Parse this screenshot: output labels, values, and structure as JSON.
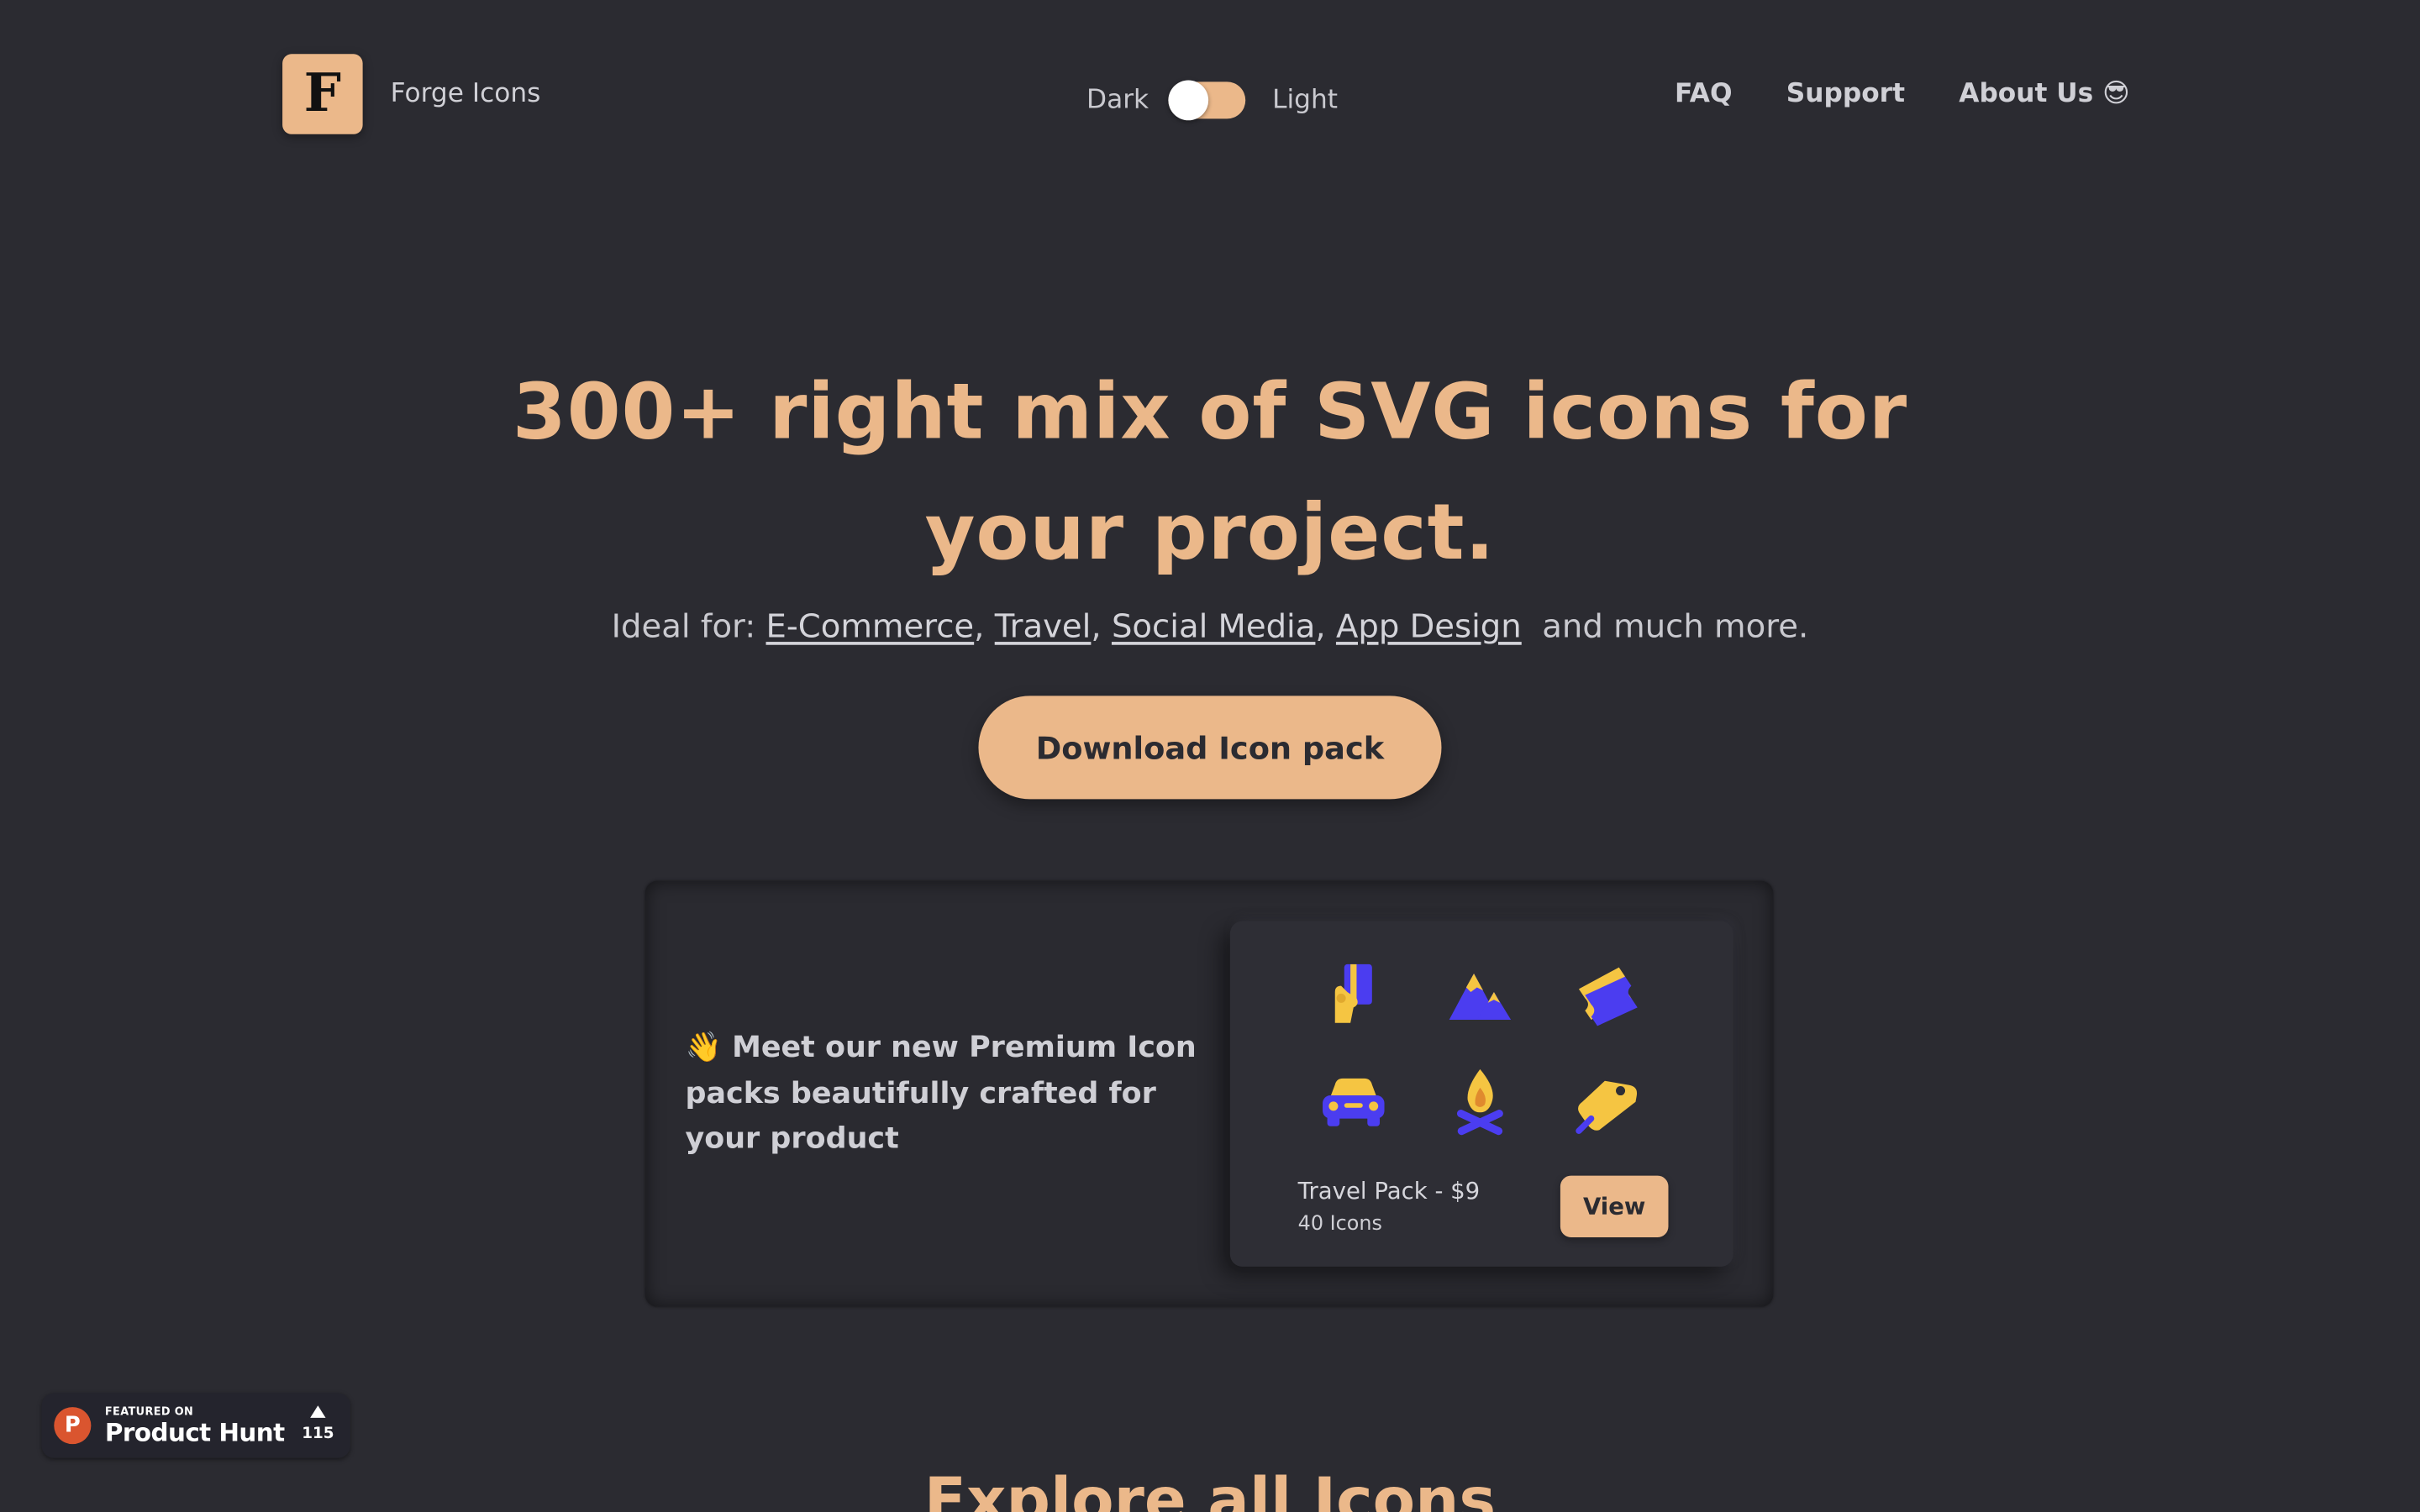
{
  "brand": {
    "logo_letter": "F",
    "name": "Forge Icons"
  },
  "theme_toggle": {
    "left_label": "Dark",
    "right_label": "Light"
  },
  "nav": {
    "faq": "FAQ",
    "support": "Support",
    "about": "About Us 😎"
  },
  "hero": {
    "title": "300+ right mix of SVG icons for your project.",
    "ideal_prefix": "Ideal for:",
    "categories": [
      "E-Commerce",
      "Travel",
      "Social Media",
      "App Design"
    ],
    "ideal_suffix": "and much more.",
    "download_label": "Download Icon pack"
  },
  "promo": {
    "text": "👋 Meet our new Premium Icon packs beautifully crafted for your product",
    "pack_title": "Travel Pack - $9",
    "pack_count": "40 Icons",
    "view_label": "View",
    "icons": [
      "card-in-hand-icon",
      "mountain-icon",
      "ticket-icon",
      "car-icon",
      "campfire-icon",
      "luggage-tag-icon"
    ]
  },
  "product_hunt": {
    "featured": "FEATURED ON",
    "name": "Product Hunt",
    "votes": "115"
  },
  "explore": {
    "heading": "Explore all Icons"
  },
  "colors": {
    "background": "#2b2b31",
    "accent": "#ebb88a",
    "icon_purple": "#4b3df0",
    "icon_yellow": "#f5c542"
  }
}
